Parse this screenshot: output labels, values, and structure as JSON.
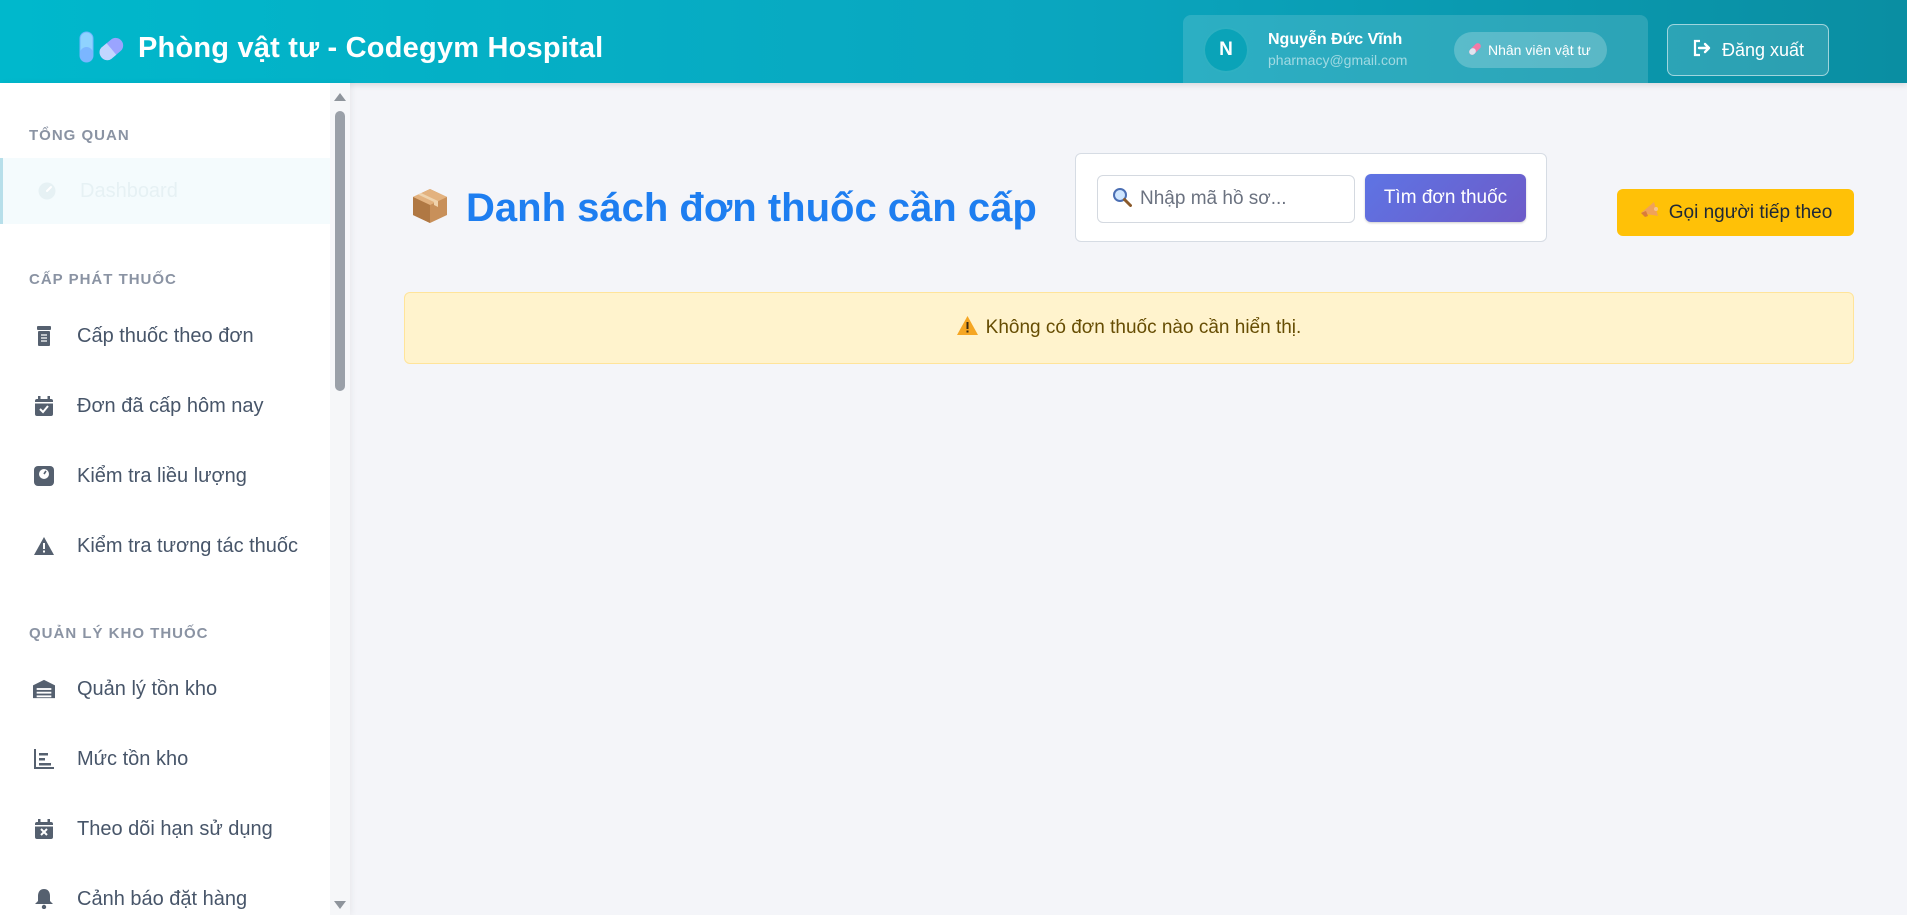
{
  "header": {
    "app_title": "Phòng vật tư - Codegym Hospital",
    "logo_icon": "pill-capsule-icon"
  },
  "user": {
    "initial": "N",
    "name": "Nguyễn Đức Vĩnh",
    "email": "pharmacy@gmail.com",
    "role": "Nhân viên vật tư",
    "logout_label": "Đăng xuất"
  },
  "sidebar": {
    "sections": [
      {
        "title": "TỔNG QUAN",
        "items": [
          {
            "label": "Dashboard",
            "icon": "dashboard-icon",
            "active": true
          }
        ]
      },
      {
        "title": "CẤP PHÁT THUỐC",
        "items": [
          {
            "label": "Cấp thuốc theo đơn",
            "icon": "prescription-bottle-icon"
          },
          {
            "label": "Đơn đã cấp hôm nay",
            "icon": "calendar-check-icon"
          },
          {
            "label": "Kiểm tra liều lượng",
            "icon": "scale-icon"
          },
          {
            "label": "Kiểm tra tương tác thuốc",
            "icon": "warning-icon"
          }
        ]
      },
      {
        "title": "QUẢN LÝ KHO THUỐC",
        "items": [
          {
            "label": "Quản lý tồn kho",
            "icon": "warehouse-icon"
          },
          {
            "label": "Mức tồn kho",
            "icon": "bar-chart-icon"
          },
          {
            "label": "Theo dõi hạn sử dụng",
            "icon": "calendar-x-icon"
          },
          {
            "label": "Cảnh báo đặt hàng",
            "icon": "bell-icon"
          }
        ]
      }
    ]
  },
  "main": {
    "title": "Danh sách đơn thuốc cần cấp",
    "title_icon": "package-icon",
    "search": {
      "placeholder": "Nhập mã hồ sơ...",
      "value": "",
      "button_label": "Tìm đơn thuốc"
    },
    "next_button_label": "Gọi người tiếp theo",
    "empty_message": "Không có đơn thuốc nào cần hiển thị."
  },
  "colors": {
    "header_gradient_start": "#00b8cc",
    "header_gradient_end": "#0a8ea2",
    "title_blue": "#1e7ef0",
    "warning_yellow": "#ffc107",
    "alert_bg": "#fff3cd"
  }
}
